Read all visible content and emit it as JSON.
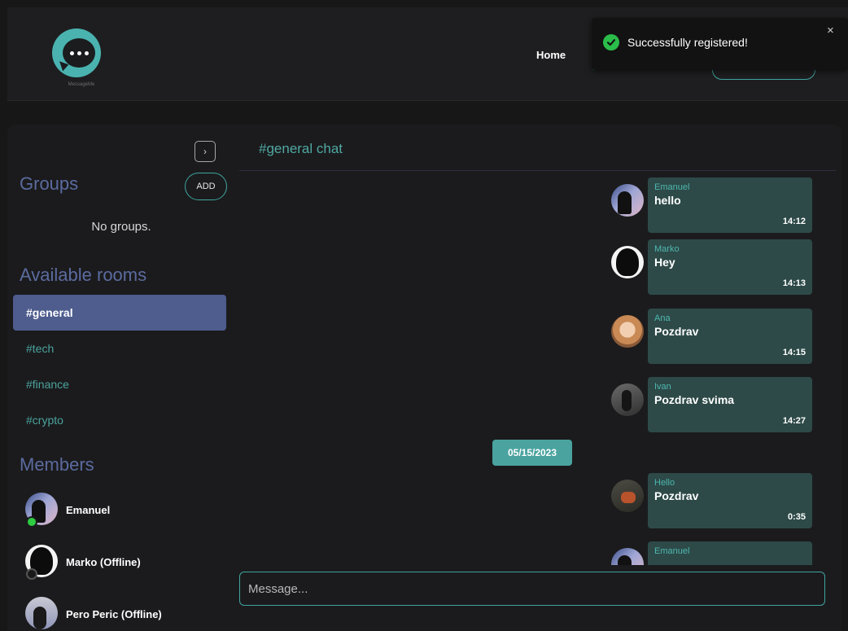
{
  "app": {
    "logo_text": "MessageMe"
  },
  "nav": {
    "home_label": "Home"
  },
  "toast": {
    "message": "Successfully registered!",
    "close_glyph": "×",
    "icon": "check-circle-icon"
  },
  "sidebar": {
    "collapse_glyph": "›",
    "groups_title": "Groups",
    "add_label": "ADD",
    "no_groups": "No groups.",
    "rooms_title": "Available rooms",
    "rooms": [
      {
        "label": "#general",
        "active": true
      },
      {
        "label": "#tech",
        "active": false
      },
      {
        "label": "#finance",
        "active": false
      },
      {
        "label": "#crypto",
        "active": false
      }
    ],
    "members_title": "Members",
    "members": [
      {
        "name": "Emanuel",
        "status": "online"
      },
      {
        "name": "Marko  (Offline)",
        "status": "offline"
      },
      {
        "name": "Pero Peric  (Offline)",
        "status": "offline"
      }
    ]
  },
  "chat": {
    "title": "#general chat",
    "date_divider": "05/15/2023",
    "messages": [
      {
        "author": "Emanuel",
        "text": "hello",
        "time": "14:12"
      },
      {
        "author": "Marko",
        "text": "Hey",
        "time": "14:13"
      },
      {
        "author": "Ana",
        "text": "Pozdrav",
        "time": "14:15"
      },
      {
        "author": "Ivan",
        "text": "Pozdrav svima",
        "time": "14:27"
      },
      {
        "author": "Hello",
        "text": "Pozdrav",
        "time": "0:35"
      },
      {
        "author": "Emanuel",
        "text": "",
        "time": ""
      }
    ],
    "input_placeholder": "Message..."
  },
  "colors": {
    "accent_teal": "#4aa39f",
    "active_room": "#4e5c8e",
    "section_title": "#5b6b9f",
    "bubble_bg": "#2d4a48",
    "online": "#2ecc40",
    "offline": "#1a1a1a"
  }
}
